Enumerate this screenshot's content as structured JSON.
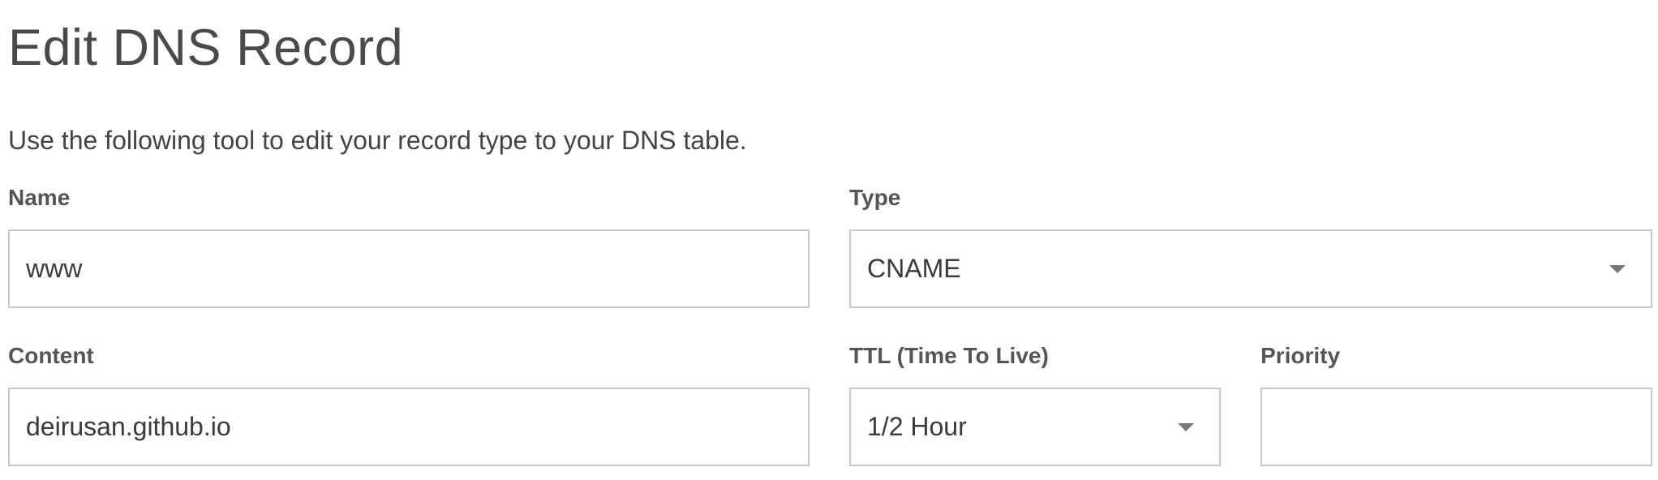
{
  "page": {
    "title": "Edit DNS Record",
    "description": "Use the following tool to edit your record type to your DNS table."
  },
  "form": {
    "name": {
      "label": "Name",
      "value": "www"
    },
    "type": {
      "label": "Type",
      "value": "CNAME"
    },
    "content": {
      "label": "Content",
      "value": "deirusan.github.io"
    },
    "ttl": {
      "label": "TTL (Time To Live)",
      "value": "1/2 Hour"
    },
    "priority": {
      "label": "Priority",
      "value": ""
    }
  },
  "colors": {
    "text": "#4a4a4a",
    "label": "#555555",
    "border": "#c8c8c8",
    "caret": "#777777",
    "background": "#ffffff"
  },
  "icons": {
    "select_caret": "chevron-down-icon"
  }
}
